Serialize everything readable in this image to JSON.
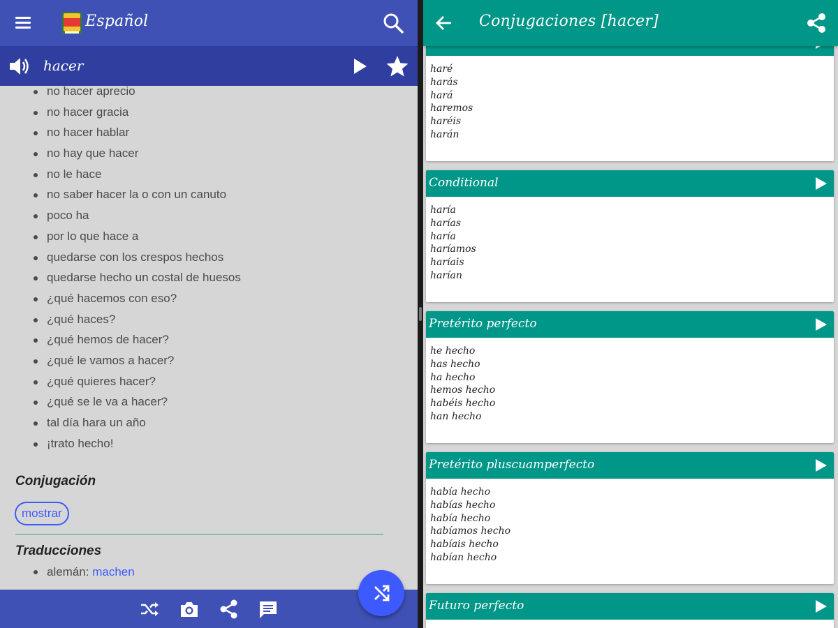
{
  "left": {
    "app_title": "Español",
    "word": "hacer",
    "phrases": [
      "no hacer aprecio",
      "no hacer gracia",
      "no hacer hablar",
      "no hay que hacer",
      "no le hace",
      "no saber hacer la o con un canuto",
      "poco ha",
      "por lo que hace a",
      "quedarse con los crespos hechos",
      "quedarse hecho un costal de huesos",
      "¿qué hacemos con eso?",
      "¿qué haces?",
      "¿qué hemos de hacer?",
      "¿qué le vamos a hacer?",
      "¿qué quieres hacer?",
      "¿qué se le va a hacer?",
      "tal día hara un año",
      "¡trato hecho!"
    ],
    "conjugation_heading": "Conjugación",
    "show_button": "mostrar",
    "translations_heading": "Traducciones",
    "translations": [
      {
        "lang": "alemán: ",
        "word": "machen"
      }
    ]
  },
  "right": {
    "title": "Conjugaciones [hacer]",
    "sections": [
      {
        "title": "",
        "forms": [
          "haré",
          "harás",
          "hará",
          "haremos",
          "haréis",
          "harán"
        ]
      },
      {
        "title": "Conditional",
        "forms": [
          "haría",
          "harías",
          "haría",
          "haríamos",
          "haríais",
          "harían"
        ]
      },
      {
        "title": "Pretérito perfecto",
        "forms": [
          "he hecho",
          "has hecho",
          "ha hecho",
          "hemos hecho",
          "habéis hecho",
          "han hecho"
        ]
      },
      {
        "title": "Pretérito pluscuamperfecto",
        "forms": [
          "había hecho",
          "habías hecho",
          "había hecho",
          "habíamos hecho",
          "habíais hecho",
          "habían hecho"
        ]
      },
      {
        "title": "Futuro perfecto",
        "forms": []
      }
    ]
  },
  "colors": {
    "indigo_appbar": "#3f51b5",
    "indigo_dark": "#303f9f",
    "teal": "#009688",
    "accent_blue": "#3d5afe",
    "pane_grey": "#d6d6d6"
  },
  "icons": {
    "menu": "menu-icon",
    "logo": "book-logo-icon",
    "search": "search-icon",
    "speaker": "speaker-icon",
    "play": "play-icon",
    "star": "star-icon",
    "shuffle": "shuffle-icon",
    "camera": "camera-icon",
    "share": "share-icon",
    "message": "message-icon",
    "back": "back-arrow-icon"
  }
}
